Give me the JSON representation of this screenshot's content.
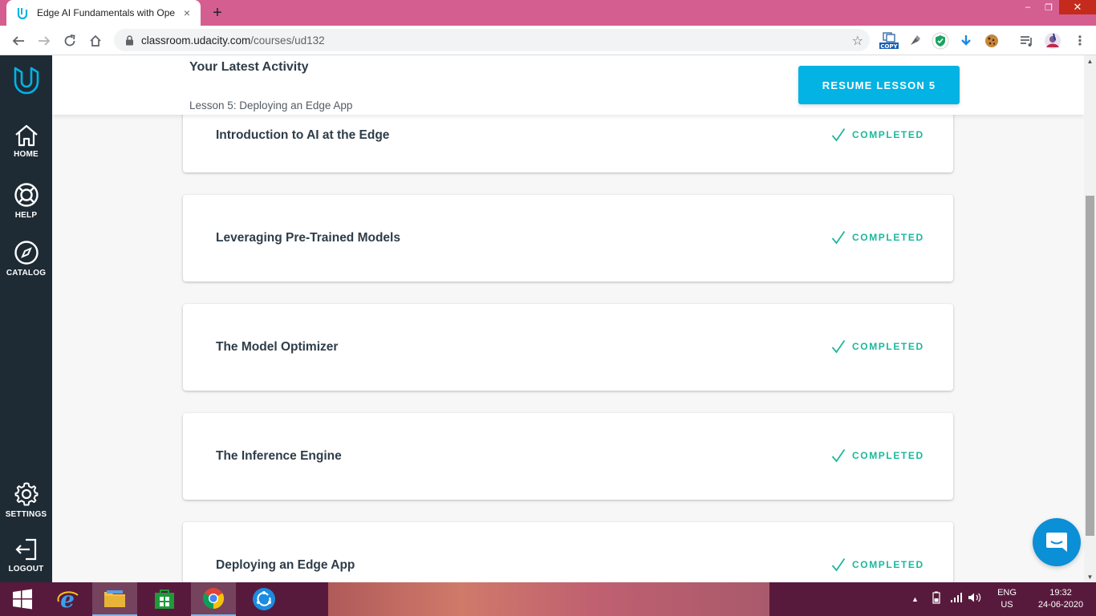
{
  "browser": {
    "tab_title": "Edge AI Fundamentals with OpenVINO",
    "tab_close": "×",
    "new_tab": "+",
    "url_host": "classroom.udacity.com",
    "url_path": "/courses/ud132",
    "window_controls": {
      "minimize": "–",
      "restore": "❐",
      "close": "✕"
    },
    "extensions": [
      "copy-extension-icon",
      "ink-extension-icon",
      "shield-extension-icon",
      "download-extension-icon",
      "cookie-extension-icon",
      "playlist-icon",
      "profile-avatar"
    ],
    "copy_badge": "COPY"
  },
  "sidebar": {
    "items": [
      {
        "label": "HOME",
        "icon": "home-icon"
      },
      {
        "label": "HELP",
        "icon": "lifebuoy-icon"
      },
      {
        "label": "CATALOG",
        "icon": "compass-icon"
      },
      {
        "label": "SETTINGS",
        "icon": "gear-icon"
      },
      {
        "label": "LOGOUT",
        "icon": "logout-icon"
      }
    ]
  },
  "activity": {
    "title": "Your Latest Activity",
    "subtitle": "Lesson 5: Deploying an Edge App",
    "resume_label": "RESUME LESSON 5"
  },
  "lessons": [
    {
      "title": "Introduction to AI at the Edge",
      "status": "COMPLETED"
    },
    {
      "title": "Leveraging Pre-Trained Models",
      "status": "COMPLETED"
    },
    {
      "title": "The Model Optimizer",
      "status": "COMPLETED"
    },
    {
      "title": "The Inference Engine",
      "status": "COMPLETED"
    },
    {
      "title": "Deploying an Edge App",
      "status": "COMPLETED"
    }
  ],
  "taskbar": {
    "apps": [
      "start-icon",
      "internet-explorer-icon",
      "file-explorer-icon",
      "store-icon",
      "chrome-icon",
      "sync-app-icon"
    ],
    "lang_top": "ENG",
    "lang_bottom": "US",
    "time": "19:32",
    "date": "24-06-2020"
  },
  "colors": {
    "accent": "#02b3e4",
    "sidebar": "#1e2b35",
    "completed": "#1cb89c",
    "tabstrip": "#d45e8f"
  }
}
